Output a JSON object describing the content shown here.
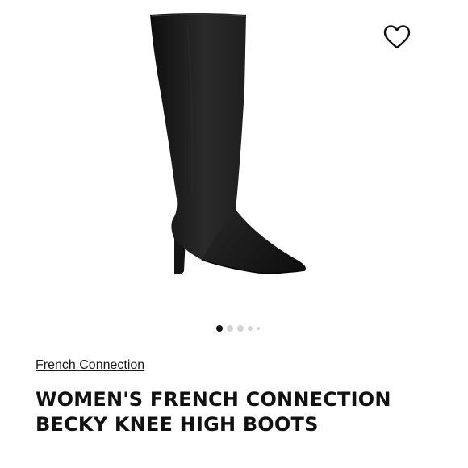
{
  "product": {
    "brand": "French Connection",
    "title": "WOMEN'S FRENCH CONNECTION BECKY KNEE HIGH BOOTS",
    "image": {
      "subject": "black knee-high boot",
      "color": "#1c1c1c"
    }
  },
  "wishlist": {
    "icon": "heart-outline-icon"
  },
  "carousel": {
    "total": 5,
    "active_index": 0
  },
  "colors": {
    "text": "#111111",
    "dot_active": "#111111",
    "dot_inactive": "#d4d4d4"
  }
}
